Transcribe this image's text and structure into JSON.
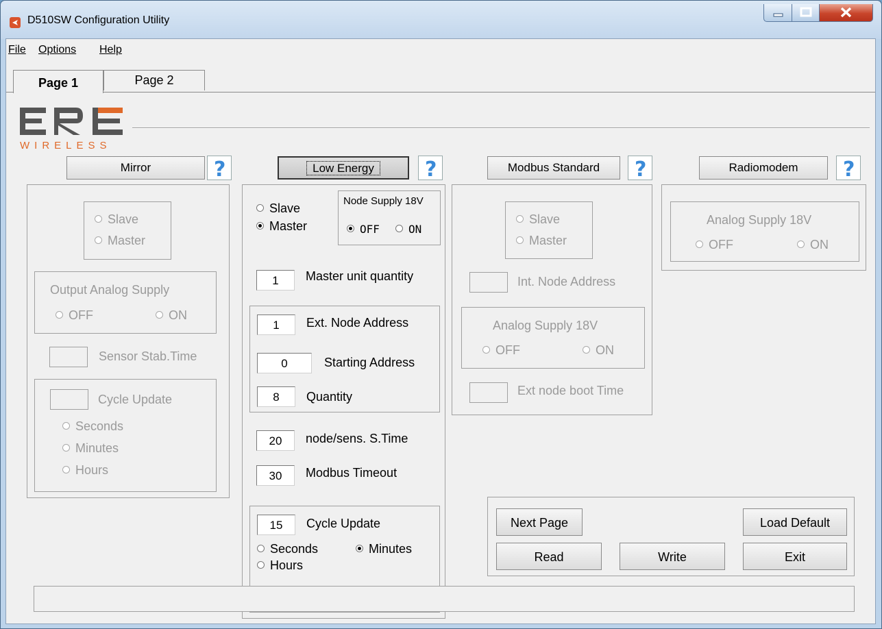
{
  "window": {
    "title": "D510SW  Configuration Utility"
  },
  "menu": {
    "items": [
      {
        "label": "File"
      },
      {
        "label": "Options"
      },
      {
        "label": "Help"
      }
    ]
  },
  "tabs": [
    {
      "label": "Page 1",
      "active": true
    },
    {
      "label": "Page 2",
      "active": false
    }
  ],
  "logo": {
    "top": "ERE",
    "bottom": "WIRELESS",
    "colors": {
      "dark": "#555555",
      "accent": "#e06a2a"
    }
  },
  "modes": {
    "mirror": "Mirror",
    "low_energy": "Low Energy",
    "modbus": "Modbus Standard",
    "radiomodem": "Radiomodem"
  },
  "mirror": {
    "slave": "Slave",
    "master": "Master",
    "output_analog_supply": "Output Analog Supply",
    "off": "OFF",
    "on": "ON",
    "sensor_stab_time": "Sensor Stab.Time",
    "sensor_stab_value": "",
    "cycle_update": "Cycle Update",
    "cycle_value": "",
    "seconds": "Seconds",
    "minutes": "Minutes",
    "hours": "Hours"
  },
  "low_energy": {
    "slave": "Slave",
    "master": "Master",
    "selected_role": "Master",
    "node_supply": "Node Supply 18V",
    "off": "OFF",
    "on": "ON",
    "node_supply_selected": "OFF",
    "master_qty_label": "Master unit quantity",
    "master_qty": "1",
    "ext_node_label": "Ext. Node Address",
    "ext_node": "1",
    "start_addr_label": "Starting Address",
    "start_addr": "0",
    "quantity_label": "Quantity",
    "quantity": "8",
    "node_stime_label": "node/sens. S.Time",
    "node_stime": "20",
    "modbus_timeout_label": "Modbus Timeout",
    "modbus_timeout": "30",
    "cycle_label": "Cycle Update",
    "cycle": "15",
    "seconds": "Seconds",
    "minutes": "Minutes",
    "hours": "Hours",
    "cycle_unit_selected": "Minutes"
  },
  "modbus": {
    "slave": "Slave",
    "master": "Master",
    "int_node_label": "Int. Node Address",
    "int_node": "",
    "analog_supply": "Analog Supply 18V",
    "off": "OFF",
    "on": "ON",
    "boot_time_label": "Ext node boot Time",
    "boot_time": ""
  },
  "radiomodem": {
    "analog_supply": "Analog Supply 18V",
    "off": "OFF",
    "on": "ON"
  },
  "actions": {
    "next_page": "Next Page",
    "load_default": "Load Default",
    "read": "Read",
    "write": "Write",
    "exit": "Exit"
  },
  "status": {
    "text": ""
  }
}
